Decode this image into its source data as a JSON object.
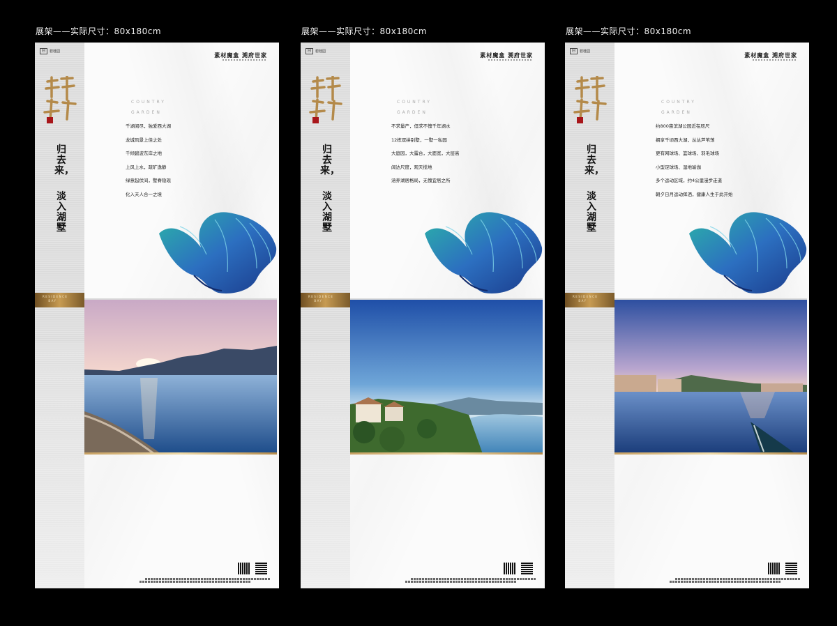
{
  "captions": [
    "展架——实际尺寸：80x180cm",
    "展架——实际尺寸：80x180cm",
    "展架——实际尺寸：80x180cm"
  ],
  "common": {
    "brand": "素材魔盒  溯府世家",
    "logo": "素材魔盒",
    "country": "COUNTRY",
    "garden": "GARDEN",
    "gold_label": [
      "RESIDENCE",
      "BAY"
    ],
    "vertical_line1": [
      "归",
      "去",
      "来，"
    ],
    "vertical_line2": [
      "淡",
      "入",
      "湖",
      "墅"
    ]
  },
  "panels": [
    {
      "lines": [
        "千湖阅尽，独爱西大湖",
        "龙城风景上佳之处",
        "千倾碧波东岸之地",
        "上风上水，疏旷逸静",
        "绿意起伏间，墅脊隐现",
        "化入天人合一之境"
      ],
      "photo": "sunset-lake"
    },
    {
      "lines": [
        "不求量产，但求不愧千年湖水",
        "12栋双拼别墅，一墅一私园",
        "大庭园，大露台，大面宽，大层高",
        "阔达尺度，观天揽地",
        "涵养湖居格局，无愧宜居之所"
      ],
      "photo": "villa-lake"
    },
    {
      "lines": [
        "约800亩滨湖公园近在咫尺",
        "拥享千顷西大湖，丛丛芦苇荡",
        "更有网球场、篮球场、羽毛球场",
        "小型足球场、湿地瑜伽",
        "多个运动区域，约4公里漫步走道",
        "朝夕日月运动挥洒，健康人生于此开始"
      ],
      "photo": "evening-lake"
    }
  ]
}
